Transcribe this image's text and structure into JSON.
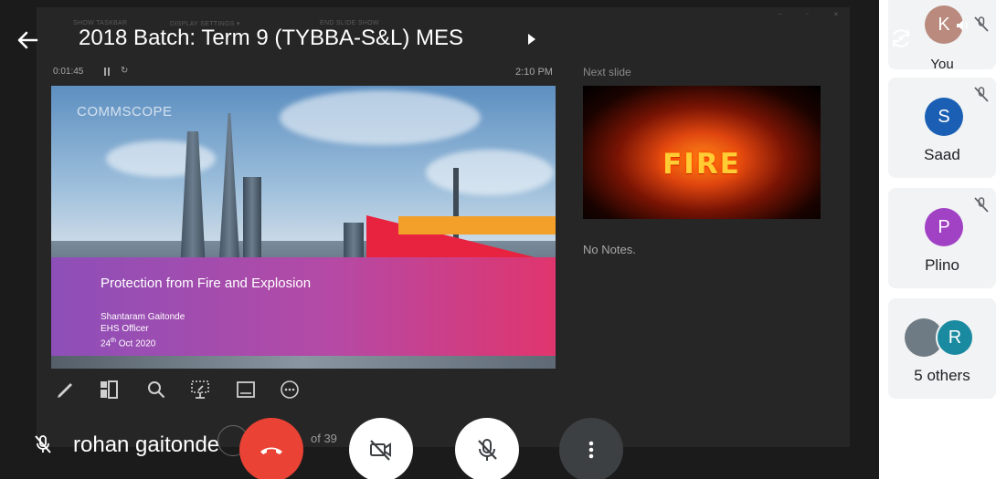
{
  "meeting": {
    "title": "2018 Batch: Term 9 (TYBBA-S&L) MES",
    "self_name": "rohan gaitonde"
  },
  "presenter_view": {
    "menu": [
      "SHOW TASKBAR",
      "DISPLAY SETTINGS ▾",
      "END SLIDE SHOW"
    ],
    "timer": "0:01:45",
    "clock": "2:10 PM",
    "next_slide_label": "Next slide",
    "notes": "No Notes.",
    "page_counter": "of 39",
    "current_slide": {
      "logo": "COMMSCOPE",
      "heading": "Protection from Fire and Explosion",
      "author": "Shantaram Gaitonde",
      "role": "EHS Officer",
      "date_day": "24",
      "date_suffix": "th",
      "date_rest": " Oct 2020"
    },
    "next_slide": {
      "text": "FIRE"
    },
    "tools": [
      "pen-icon",
      "slides-grid-icon",
      "zoom-icon",
      "laser-pointer-icon",
      "subtitles-icon",
      "more-options-icon"
    ]
  },
  "controls": {
    "end_call": "end-call-icon",
    "camera": "camera-off-icon",
    "microphone": "mic-off-icon",
    "more": "more-vert-icon"
  },
  "participants": [
    {
      "initial": "K",
      "name": "You",
      "color": "#b98a7d"
    },
    {
      "initial": "S",
      "name": "Saad",
      "color": "#1a5fb4"
    },
    {
      "initial": "P",
      "name": "Plino",
      "color": "#a142c4"
    },
    {
      "initial": "R",
      "name": "5 others",
      "color": "#1a8aa0"
    }
  ],
  "colors": {
    "end_call": "#ea4335",
    "stage": "#1b1b1b",
    "panel_tile": "#f1f3f4"
  }
}
